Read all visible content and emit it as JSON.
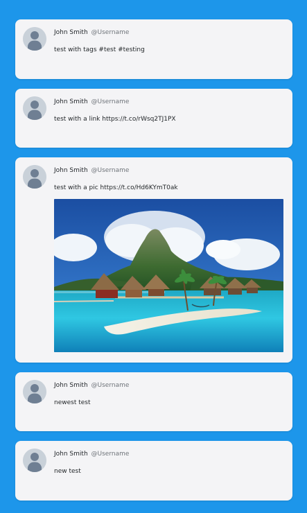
{
  "posts": [
    {
      "author_name": "John Smith",
      "author_handle": "@Username",
      "text": "test with tags #test #testing"
    },
    {
      "author_name": "John Smith",
      "author_handle": "@Username",
      "text": "test with a link https://t.co/rWsq2TJ1PX"
    },
    {
      "author_name": "John Smith",
      "author_handle": "@Username",
      "text": "test with a pic https://t.co/Hd6KYmT0ak",
      "media": {
        "type": "image",
        "subject": "overwater-bungalows-island-photo"
      }
    },
    {
      "author_name": "John Smith",
      "author_handle": "@Username",
      "text": "newest test"
    },
    {
      "author_name": "John Smith",
      "author_handle": "@Username",
      "text": "new test"
    }
  ],
  "icons": {
    "avatar": "default-user-avatar-icon"
  },
  "colors": {
    "background": "#1d96ea",
    "card": "#f4f4f6",
    "avatar_bg": "#c9d1d9",
    "avatar_figure": "#6f7f93"
  }
}
